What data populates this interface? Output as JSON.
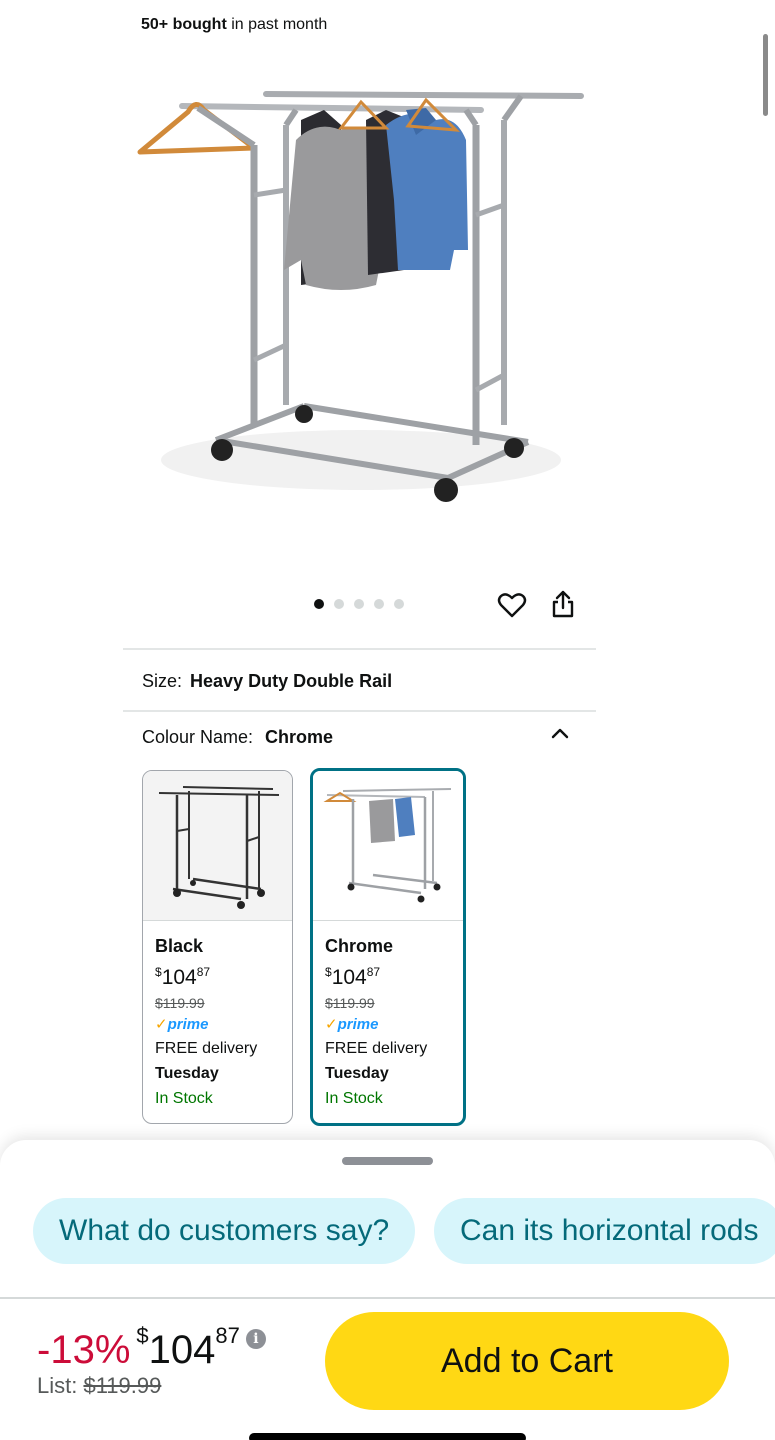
{
  "header": {
    "bought_bold": "50+ bought",
    "bought_rest": " in past month"
  },
  "gallery": {
    "image_count": 5,
    "active_index": 0,
    "heart_icon": "heart-icon",
    "share_icon": "share-icon"
  },
  "variations": {
    "size_label": "Size:",
    "size_value": "Heavy Duty Double Rail",
    "colour_label": "Colour Name:",
    "colour_value": "Chrome",
    "options": [
      {
        "name": "Black",
        "currency": "$",
        "price_whole": "104",
        "price_fraction": "87",
        "list_price": "$119.99",
        "prime_check": "✓",
        "prime": "prime",
        "delivery": "FREE delivery",
        "delivery_day": "Tuesday",
        "stock": "In Stock"
      },
      {
        "name": "Chrome",
        "currency": "$",
        "price_whole": "104",
        "price_fraction": "87",
        "list_price": "$119.99",
        "prime_check": "✓",
        "prime": "prime",
        "delivery": "FREE delivery",
        "delivery_day": "Tuesday",
        "stock": "In Stock"
      }
    ]
  },
  "assistant": {
    "chips": [
      "What do customers say?",
      "Can its horizontal rods"
    ]
  },
  "buybox": {
    "discount": "-13%",
    "currency": "$",
    "price_whole": "104",
    "price_fraction": "87",
    "info_glyph": "i",
    "list_label": "List: ",
    "list_price": "$119.99",
    "add_to_cart": "Add to Cart"
  },
  "colors": {
    "accent_teal": "#007185",
    "cart_yellow": "#ffd814",
    "deal_red": "#cc0c39",
    "stock_green": "#007600",
    "prime_blue": "#1a98ff",
    "chip_bg": "#d7f5fb"
  }
}
